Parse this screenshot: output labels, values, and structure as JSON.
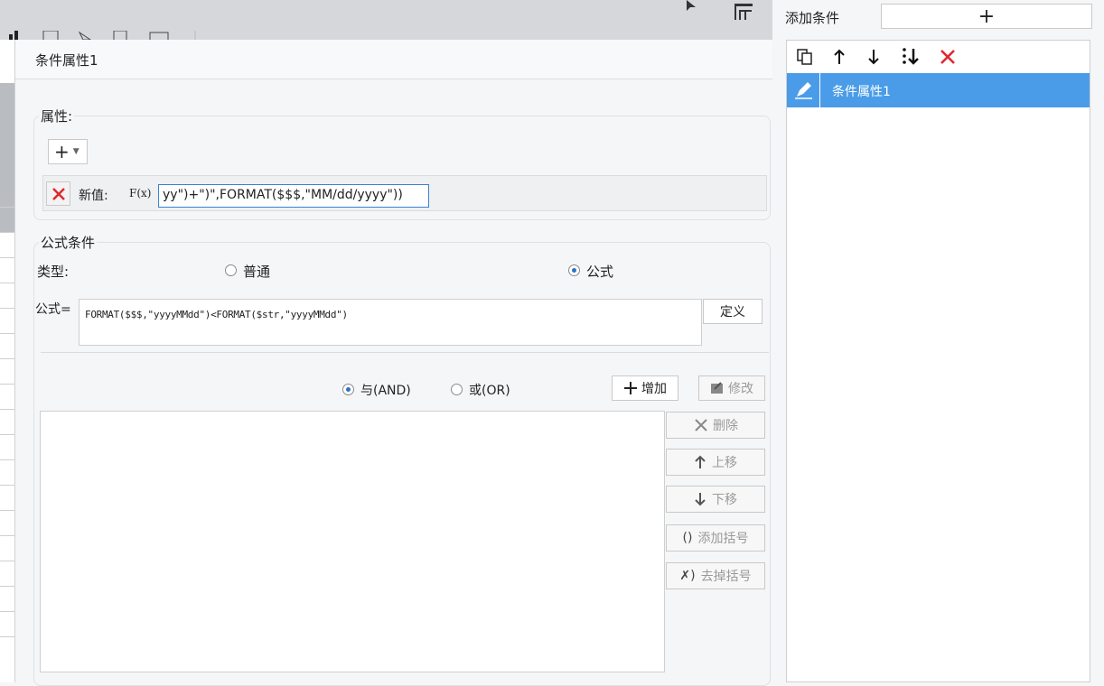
{
  "right_panel": {
    "add_condition_label": "添加条件",
    "add_button_symbol": "+",
    "selected_item_label": "条件属性1"
  },
  "dialog": {
    "title": "条件属性1",
    "attributes": {
      "group_label": "属性:",
      "add_symbol": "+",
      "new_value_label": "新值:",
      "formula_icon_text": "F(x)",
      "value_text": "yy\")+\")\",FORMAT($$$,\"MM/dd/yyyy\"))"
    },
    "formula_condition": {
      "group_label": "公式条件",
      "type_label": "类型:",
      "option_normal": "普通",
      "option_formula": "公式",
      "formula_label": "公式=",
      "formula_text": "FORMAT($$$,\"yyyyMMdd\")<FORMAT($str,\"yyyyMMdd\")",
      "define_button": "定义",
      "and_label": "与(AND)",
      "or_label": "或(OR)",
      "add_button": "增加",
      "modify_button": "修改",
      "delete_button": "删除",
      "move_up_button": "上移",
      "move_down_button": "下移",
      "add_bracket_button": "添加括号",
      "remove_bracket_button": "去掉括号"
    }
  }
}
